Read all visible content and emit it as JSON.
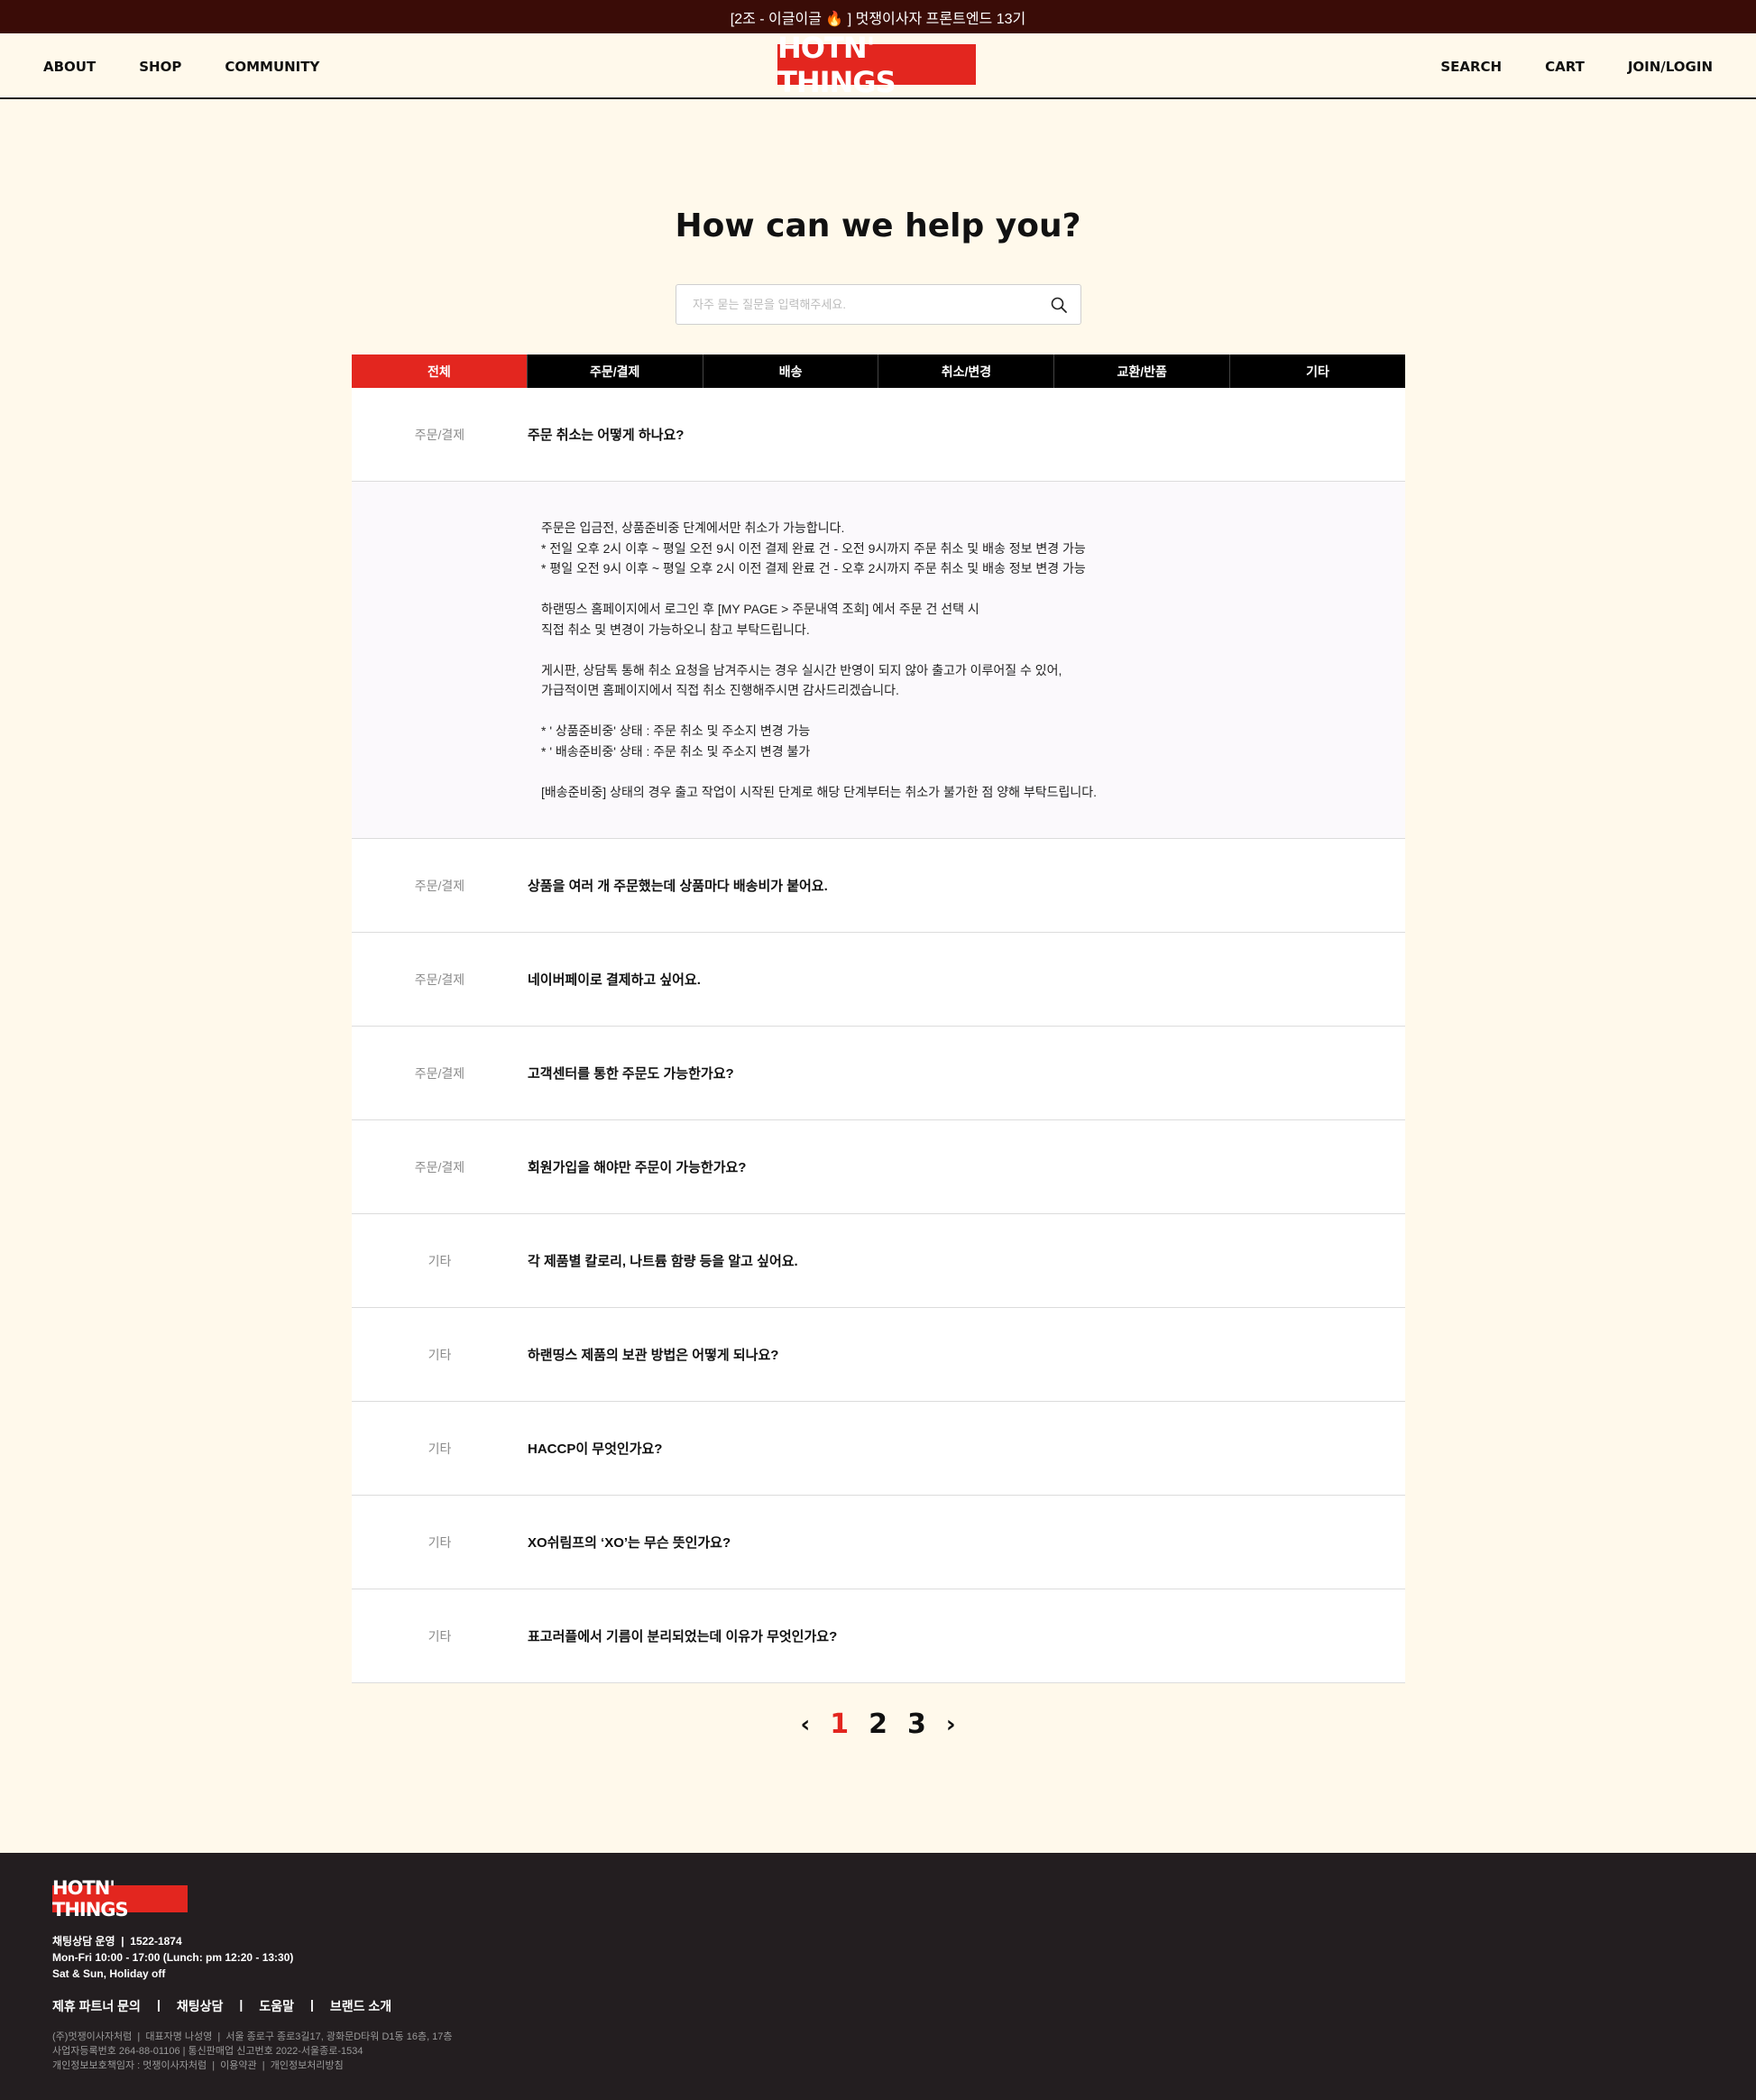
{
  "topbar": {
    "text": "[2조 - 이글이글 🔥 ] 멋쟁이사자 프론트엔드 13기"
  },
  "header": {
    "logo": "HOTN' THINGS",
    "nav_left": [
      "ABOUT",
      "SHOP",
      "COMMUNITY"
    ],
    "nav_right": [
      "SEARCH",
      "CART",
      "JOIN/LOGIN"
    ]
  },
  "main": {
    "title": "How can we help you?",
    "search": {
      "placeholder": "자주 묻는 질문을 입력해주세요.",
      "value": ""
    },
    "tabs": [
      "전체",
      "주문/결제",
      "배송",
      "취소/변경",
      "교환/반품",
      "기타"
    ],
    "active_tab": "전체",
    "faqs": [
      {
        "category": "주문/결제",
        "question": "주문 취소는 어떻게 하나요?"
      },
      {
        "category": "주문/결제",
        "question": "상품을 여러 개 주문했는데 상품마다 배송비가 붙어요."
      },
      {
        "category": "주문/결제",
        "question": "네이버페이로 결제하고 싶어요."
      },
      {
        "category": "주문/결제",
        "question": "고객센터를 통한 주문도 가능한가요?"
      },
      {
        "category": "주문/결제",
        "question": "회원가입을 해야만 주문이 가능한가요?"
      },
      {
        "category": "기타",
        "question": "각 제품별 칼로리, 나트륨 함량 등을 알고 싶어요."
      },
      {
        "category": "기타",
        "question": "하랜띵스 제품의 보관 방법은 어떻게 되나요?"
      },
      {
        "category": "기타",
        "question": "HACCP이 무엇인가요?"
      },
      {
        "category": "기타",
        "question": "XO쉬림프의 ‘XO’는 무슨 뜻인가요?"
      },
      {
        "category": "기타",
        "question": "표고러플에서 기름이 분리되었는데 이유가 무엇인가요?"
      }
    ],
    "answer": [
      "주문은 입금전, 상품준비중 단계에서만 취소가 가능합니다.",
      "* 전일 오후 2시 이후 ~ 평일 오전 9시 이전 결제 완료 건 - 오전 9시까지 주문 취소 및 배송 정보 변경 가능",
      "* 평일 오전 9시 이후 ~ 평일 오후 2시 이전 결제 완료 건 - 오후 2시까지 주문 취소 및 배송 정보 변경 가능",
      "",
      "하랜띵스 홈페이지에서 로그인 후 [MY PAGE > 주문내역 조회] 에서 주문 건 선택 시",
      "직접 취소 및 변경이 가능하오니 참고 부탁드립니다.",
      "",
      "게시판, 상담톡 통해 취소 요청을 남겨주시는 경우 실시간 반영이 되지 않아 출고가 이루어질 수 있어,",
      "가급적이면 홈페이지에서 직접 취소 진행해주시면 감사드리겠습니다.",
      "",
      "* ' 상품준비중' 상태 : 주문 취소 및 주소지 변경 가능",
      "* ' 배송준비중' 상태 : 주문 취소 및 주소지 변경 불가",
      "",
      "[배송준비중] 상태의 경우 출고 작업이 시작된 단계로 해당 단계부터는 취소가 불가한 점 양해 부탁드립니다."
    ],
    "pagination": {
      "prev": "‹",
      "pages": [
        "1",
        "2",
        "3"
      ],
      "current": "1",
      "next": "›"
    }
  },
  "footer": {
    "logo": "HOTN' THINGS",
    "info": [
      "채팅상담 운영  |  1522-1874",
      "Mon-Fri 10:00 - 17:00 (Lunch: pm 12:20 - 13:30)",
      "Sat & Sun, Holiday off"
    ],
    "links": [
      "제휴 파트너 문의",
      "채팅상담",
      "도움말",
      "브랜드 소개"
    ],
    "link_separator": "|",
    "legal": [
      "(주)멋쟁이사자처럼  |  대표자명 나성영  |  서울 종로구 종로3길17, 광화문D타워 D1동 16층, 17층",
      "사업자등록번호 264-88-01106 | 통신판매업 신고번호 2022-서울종로-1534",
      "개인정보보호책임자 : 멋쟁이사자처럼  |  이용약관  |  개인정보처리방침"
    ]
  },
  "colors": {
    "accent": "#e3261f",
    "topbar_bg": "#3a0c07",
    "page_bg": "#fff9eb",
    "footer_bg": "#231e20"
  }
}
